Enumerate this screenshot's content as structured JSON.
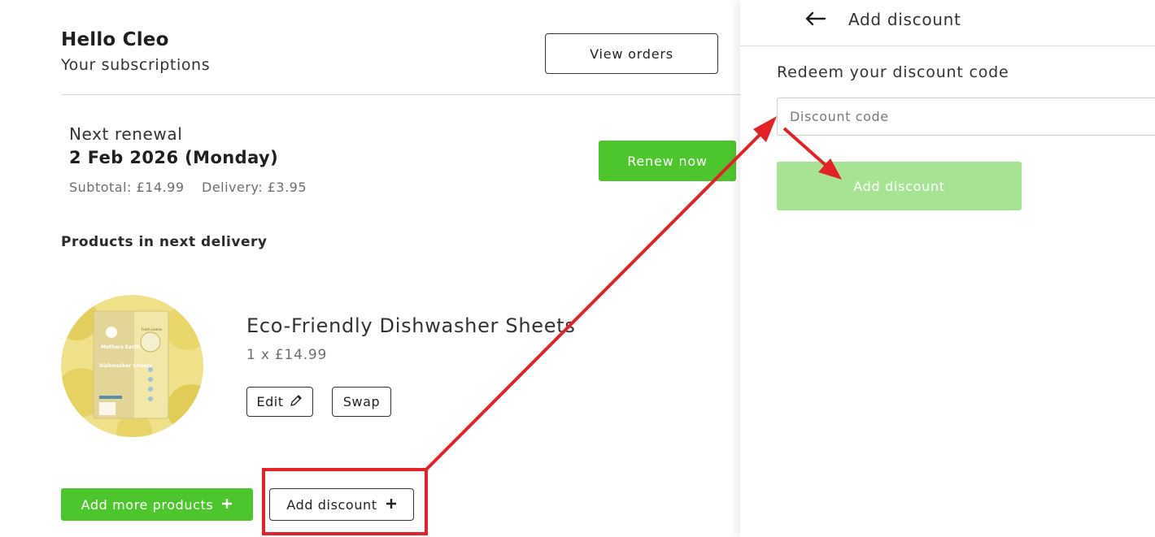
{
  "header": {
    "greeting": "Hello Cleo",
    "subtitle": "Your subscriptions",
    "view_orders_label": "View orders"
  },
  "renewal": {
    "label": "Next renewal",
    "date": "2 Feb 2026 (Monday)",
    "subtotal": "Subtotal: £14.99",
    "delivery": "Delivery: £3.95",
    "renew_now_label": "Renew now"
  },
  "products": {
    "heading": "Products in next delivery",
    "items": [
      {
        "name": "Eco-Friendly Dishwasher Sheets",
        "quantity_price": "1 x £14.99",
        "edit_label": "Edit",
        "swap_label": "Swap",
        "image_text": {
          "brand": "Mothers Earth",
          "product": "Dishwasher Sheets",
          "scent": "Fresh Lemon"
        }
      }
    ]
  },
  "actions": {
    "add_more_label": "Add more products",
    "add_discount_label": "Add discount"
  },
  "panel": {
    "title": "Add discount",
    "redeem_label": "Redeem your discount code",
    "input_placeholder": "Discount code",
    "input_value": "",
    "submit_label": "Add discount"
  },
  "icons": {
    "back": "arrow-left-icon",
    "edit": "pencil-icon",
    "plus": "plus-icon"
  },
  "colors": {
    "primary_green": "#4cc62c",
    "disabled_green": "#a6e392",
    "annotation_red": "#e32227"
  }
}
